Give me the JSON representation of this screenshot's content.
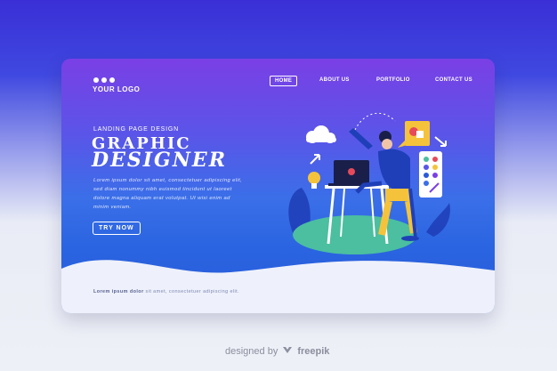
{
  "header": {
    "logo_text": "YOUR LOGO",
    "nav": [
      {
        "label": "HOME",
        "active": true
      },
      {
        "label": "ABOUT US",
        "active": false
      },
      {
        "label": "PORTFOLIO",
        "active": false
      },
      {
        "label": "CONTACT US",
        "active": false
      }
    ]
  },
  "hero": {
    "kicker": "LANDING PAGE DESIGN",
    "title_line1": "GRAPHIC",
    "title_line2": "DESIGNER",
    "body": "Lorem ipsum dolor sit amet, consectetuer adipiscing elit, sed diam nonummy nibh euismod tincidunt ut laoreet dolore magna aliquam erat volutpat. Ut wisi enim ad minim veniam.",
    "cta_label": "TRY NOW"
  },
  "footer": {
    "bold": "Lorem ipsum dolor",
    "rest": "sit amet, consectetuer adipiscing elit."
  },
  "watermark": {
    "prefix": "designed by",
    "brand": "freepik"
  },
  "colors": {
    "card_top": "#7a3fe6",
    "card_bottom": "#2a5ad8",
    "accent_yellow": "#f5c33b",
    "accent_blue": "#1f3fb8",
    "accent_green": "#4bbf9f"
  }
}
